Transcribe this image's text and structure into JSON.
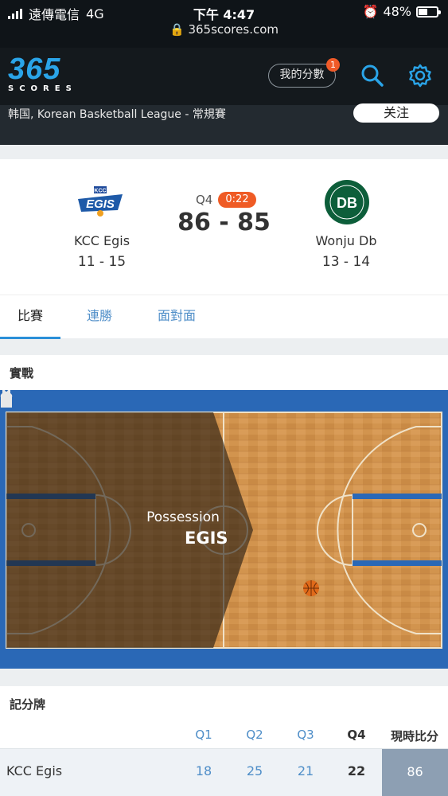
{
  "status_bar": {
    "carrier": "遠傳電信",
    "network": "4G",
    "time": "下午 4:47",
    "url": "365scores.com",
    "battery": "48%",
    "battery_level": 0.48
  },
  "header": {
    "logo_number": "365",
    "logo_word": "SCORES",
    "my_scores_label": "我的分數",
    "my_scores_badge": "1",
    "league": "韩国, Korean Basketball League - 常規賽",
    "follow_label": "关注",
    "brand_color": "#2aa4e8",
    "accent_color": "#f05a28"
  },
  "match": {
    "home": {
      "name": "KCC Egis",
      "record": "11 - 15",
      "logo_text": "EGIS"
    },
    "away": {
      "name": "Wonju Db",
      "record": "13 - 14",
      "logo_text": "DB"
    },
    "period": "Q4",
    "clock": "0:22",
    "score": "86 - 85"
  },
  "tabs": [
    {
      "label": "比賽",
      "active": true
    },
    {
      "label": "連勝",
      "active": false
    },
    {
      "label": "面對面",
      "active": false
    }
  ],
  "live": {
    "title": "實戰",
    "possession_label": "Possession",
    "possession_team": "EGIS"
  },
  "scoreboard": {
    "title": "記分牌",
    "columns": [
      "Q1",
      "Q2",
      "Q3",
      "Q4",
      "現時比分"
    ],
    "rows": [
      {
        "team": "KCC Egis",
        "q1": "18",
        "q2": "25",
        "q3": "21",
        "q4": "22",
        "total": "86"
      }
    ]
  }
}
